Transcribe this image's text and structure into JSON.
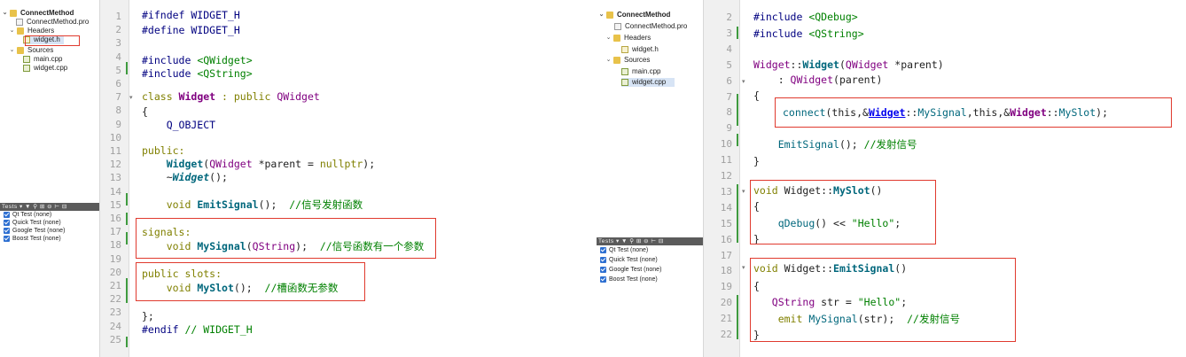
{
  "left": {
    "project": {
      "name": "ConnectMethod",
      "pro_file": "ConnectMethod.pro",
      "headers_folder": "Headers",
      "header_file": "widget.h",
      "sources_folder": "Sources",
      "main_file": "main.cpp",
      "widget_file": "widget.cpp"
    },
    "tests": {
      "label": "Tests",
      "items": [
        "Qt Test (none)",
        "Quick Test (none)",
        "Google Test (none)",
        "Boost Test (none)"
      ]
    },
    "line_numbers": [
      "1",
      "2",
      "3",
      "4",
      "5",
      "6",
      "7",
      "8",
      "9",
      "10",
      "11",
      "12",
      "13",
      "14",
      "15",
      "16",
      "17",
      "18",
      "19",
      "20",
      "21",
      "22",
      "23",
      "24",
      "25"
    ],
    "code": {
      "l1": "#ifndef WIDGET_H",
      "l2": "#define WIDGET_H",
      "l4a": "#include ",
      "l4b": "<QWidget>",
      "l5a": "#include ",
      "l5b": "<QString>",
      "l7a": "class ",
      "l7b": "Widget",
      "l7c": " : public ",
      "l7d": "QWidget",
      "l8": "{",
      "l9": "    Q_OBJECT",
      "l11": "public:",
      "l12a": "    ",
      "l12b": "Widget",
      "l12c": "(",
      "l12d": "QWidget",
      "l12e": " *parent = ",
      "l12f": "nullptr",
      "l12g": ");",
      "l13a": "    ~",
      "l13b": "Widget",
      "l13c": "();",
      "l15a": "    ",
      "l15b": "void",
      "l15c": " ",
      "l15d": "EmitSignal",
      "l15e": "();  ",
      "l15f": "//信号发射函数",
      "l17": "signals:",
      "l18a": "    ",
      "l18b": "void",
      "l18c": " ",
      "l18d": "MySignal",
      "l18e": "(",
      "l18f": "QString",
      "l18g": ");  ",
      "l18h": "//信号函数有一个参数",
      "l20a": "public",
      "l20b": " slots:",
      "l21a": "    ",
      "l21b": "void",
      "l21c": " ",
      "l21d": "MySlot",
      "l21e": "();  ",
      "l21f": "//槽函数无参数",
      "l23": "};",
      "l24a": "#endif ",
      "l24b": "// WIDGET_H"
    }
  },
  "right": {
    "project": {
      "name": "ConnectMethod",
      "pro_file": "ConnectMethod.pro",
      "headers_folder": "Headers",
      "header_file": "widget.h",
      "sources_folder": "Sources",
      "main_file": "main.cpp",
      "widget_file": "widget.cpp"
    },
    "tests": {
      "label": "Tests",
      "items": [
        "Qt Test (none)",
        "Quick Test (none)",
        "Google Test (none)",
        "Boost Test (none)"
      ]
    },
    "line_numbers": [
      "2",
      "3",
      "4",
      "5",
      "6",
      "7",
      "8",
      "9",
      "10",
      "11",
      "12",
      "13",
      "14",
      "15",
      "16",
      "17",
      "18",
      "19",
      "20",
      "21",
      "22"
    ],
    "code": {
      "r2a": "#include ",
      "r2b": "<QDebug>",
      "r3a": "#include ",
      "r3b": "<QString>",
      "r5a": "Widget",
      "r5b": "::",
      "r5c": "Widget",
      "r5d": "(",
      "r5e": "QWidget",
      "r5f": " *parent)",
      "r6a": "    : ",
      "r6b": "QWidget",
      "r6c": "(parent)",
      "r7": "{",
      "r8a": "connect",
      "r8b": "(this,&",
      "r8c": "Widget",
      "r8d": "::",
      "r8e": "MySignal",
      "r8f": ",this,&",
      "r8g": "Widget",
      "r8h": "::",
      "r8i": "MySlot",
      "r8j": ");",
      "r10a": "    ",
      "r10b": "EmitSignal",
      "r10c": "(); ",
      "r10d": "//发射信号",
      "r11": "}",
      "r13a": "void",
      "r13b": " Widget::",
      "r13c": "MySlot",
      "r13d": "()",
      "r14": "{",
      "r15a": "    ",
      "r15b": "qDebug",
      "r15c": "() << ",
      "r15d": "\"Hello\"",
      "r15e": ";",
      "r16": "}",
      "r18a": "void",
      "r18b": " Widget::",
      "r18c": "EmitSignal",
      "r18d": "()",
      "r19": "{",
      "r20a": "   ",
      "r20b": "QString",
      "r20c": " str = ",
      "r20d": "\"Hello\"",
      "r20e": ";",
      "r21a": "    emit ",
      "r21b": "MySignal",
      "r21c": "(str);  ",
      "r21d": "//发射信号",
      "r22": "}"
    }
  },
  "colors": {
    "highlight_box": "#e03a2e",
    "keyword": "#808000",
    "class": "#800080",
    "function": "#00677c",
    "string_comment": "#008000",
    "preprocessor": "#000080"
  }
}
